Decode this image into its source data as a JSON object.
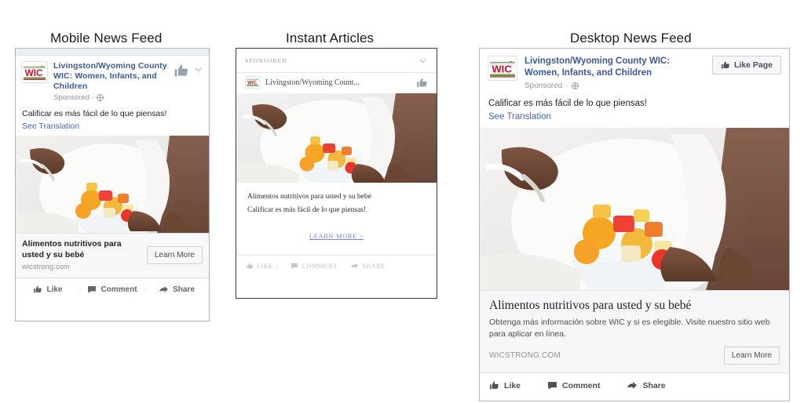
{
  "panels": [
    {
      "title": "Mobile News Feed"
    },
    {
      "title": "Instant Articles"
    },
    {
      "title": "Desktop News Feed"
    }
  ],
  "brand": {
    "page_name": "Livingston/Wyoming County WIC: Women, Infants, and Children",
    "page_name_truncated": "Livingston/Wyoming Count...",
    "logo_text": "WIC",
    "logo_colors": {
      "text": "#c8102e",
      "band": "#5f9c43",
      "leaf": "#5f9c43"
    },
    "link_color": "#4267b2",
    "title_color": "#3b5998"
  },
  "mobile": {
    "sponsored_label": "Sponsored",
    "privacy_icon": "globe-icon",
    "post_text": "Calificar es más fácil de lo que piensas!",
    "see_translation": "See Translation",
    "image_alt": "Pregnant woman in white holding a glass bowl of fresh fruit salad",
    "cta_title": "Alimentos nutritivos para usted y su bebé",
    "cta_url": "wicstrong.com",
    "cta_button": "Learn More",
    "actions": [
      {
        "label": "Like",
        "icon": "thumbs-up-icon"
      },
      {
        "label": "Comment",
        "icon": "comment-icon"
      },
      {
        "label": "Share",
        "icon": "share-icon"
      }
    ]
  },
  "instant_articles": {
    "sponsored_label": "SPONSORED",
    "chevron_icon": "chevron-down-icon",
    "thumb_icon": "thumbs-up-icon",
    "page_name": "Livingston/Wyoming Count...",
    "image_alt": "Pregnant woman in white holding a glass bowl of fresh fruit salad",
    "line1": "Alimentos nutritivos para usted y su bebé",
    "line2": "Calificar es más fácil de lo que piensas!",
    "learn_more": "LEARN MORE >",
    "actions": [
      {
        "label": "LIKE",
        "icon": "thumbs-up-icon"
      },
      {
        "label": "COMMENT",
        "icon": "comment-icon"
      },
      {
        "label": "SHARE",
        "icon": "share-icon"
      }
    ],
    "separator": "|"
  },
  "desktop": {
    "page_name": "Livingston/Wyoming County WIC: Women, Infants, and Children",
    "sponsored_label": "Sponsored",
    "privacy_icon": "globe-icon",
    "like_page_button": "Like Page",
    "post_text": "Calificar es más fácil de lo que piensas!",
    "see_translation": "See Translation",
    "image_alt": "Pregnant woman in white holding a glass bowl of fresh fruit salad",
    "cta_title": "Alimentos nutritivos para usted y su bebé",
    "cta_description": "Obtenga más información sobre WIC y si es elegible. Visite nuestro sitio web para aplicar en línea.",
    "cta_url": "WICSTRONG.COM",
    "cta_button": "Learn More",
    "actions": [
      {
        "label": "Like",
        "icon": "thumbs-up-icon"
      },
      {
        "label": "Comment",
        "icon": "comment-icon"
      },
      {
        "label": "Share",
        "icon": "share-icon"
      }
    ]
  }
}
